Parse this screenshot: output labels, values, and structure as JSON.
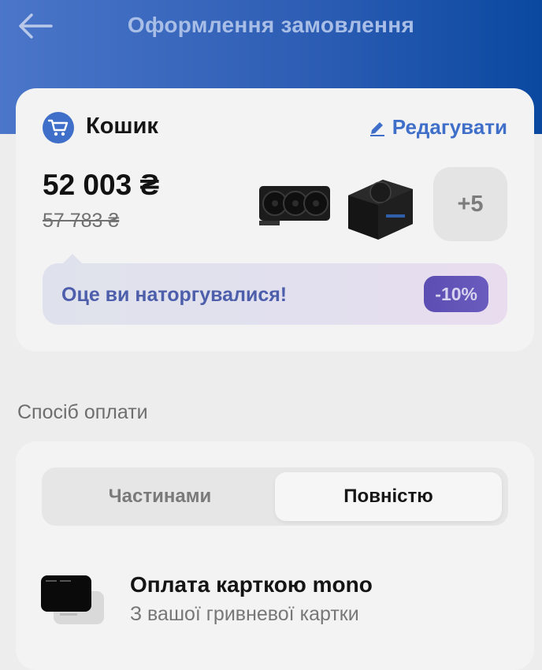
{
  "header": {
    "title": "Оформлення замовлення"
  },
  "cart": {
    "title": "Кошик",
    "edit_label": "Редагувати",
    "price": "52 003 ₴",
    "old_price": "57 783 ₴",
    "more_count": "+5",
    "items": [
      {
        "icon": "graphics-card-image"
      },
      {
        "icon": "power-supply-image"
      }
    ],
    "banner": {
      "text": "Оце ви наторгувалися!",
      "discount": "-10%"
    }
  },
  "payment": {
    "section_label": "Спосіб оплати",
    "tabs": [
      {
        "label": "Частинами",
        "selected": false
      },
      {
        "label": "Повністю",
        "selected": true
      }
    ],
    "method": {
      "title": "Оплата карткою mono",
      "subtitle": "З вашої гривневої картки"
    }
  },
  "colors": {
    "accent": "#3f6fc9",
    "header": "#2b5cb3",
    "discount": "#5b4db1"
  }
}
